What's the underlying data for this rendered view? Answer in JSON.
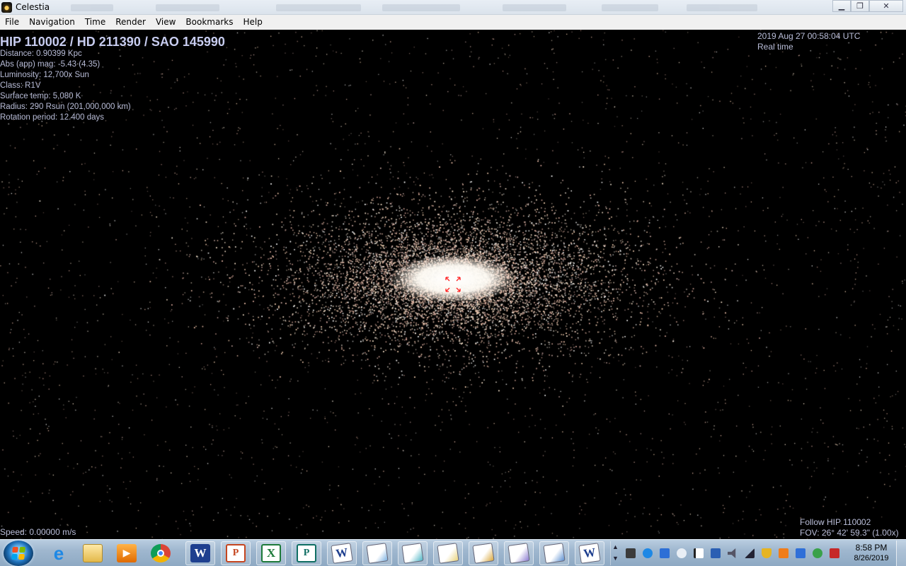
{
  "window": {
    "title": "Celestia"
  },
  "menu": [
    "File",
    "Navigation",
    "Time",
    "Render",
    "View",
    "Bookmarks",
    "Help"
  ],
  "selection": {
    "name": "HIP 110002 / HD 211390 / SAO 145990",
    "details": [
      "Distance: 0.90399 Kpc",
      "Abs (app) mag: -5.43 (4.35)",
      "Luminosity: 12,700x Sun",
      "Class: R1V",
      "Surface temp: 5,080 K",
      "Radius: 290 Rsun  (201,000,000 km)",
      "Rotation period: 12.400 days"
    ]
  },
  "time": {
    "datetime": "2019 Aug 27 00:58:04 UTC",
    "mode": "Real time"
  },
  "status": {
    "speed": "Speed: 0.00000 m/s",
    "follow": "Follow HIP 110002",
    "fov": "FOV: 26° 42' 59.3\" (1.00x)"
  },
  "taskbar": {
    "icons": [
      "start-orb",
      "internet-explorer-icon",
      "file-explorer-icon",
      "media-player-icon",
      "chrome-icon",
      "word-icon",
      "powerpoint-icon",
      "excel-icon",
      "publisher-icon",
      "wordpad-doc-icon",
      "document-icon",
      "sketch-doc-icon",
      "mail-doc-icon",
      "form-doc-icon",
      "settings-doc-icon",
      "clock-doc-icon",
      "word-doc-icon"
    ],
    "clock_time": "8:58 PM",
    "clock_date": "8/26/2019"
  },
  "colors": {
    "viewport_bg": "#000000",
    "overlay_text": "#b9bdd8",
    "marker": "#ff2020",
    "galaxy_core": "#ffffff"
  }
}
